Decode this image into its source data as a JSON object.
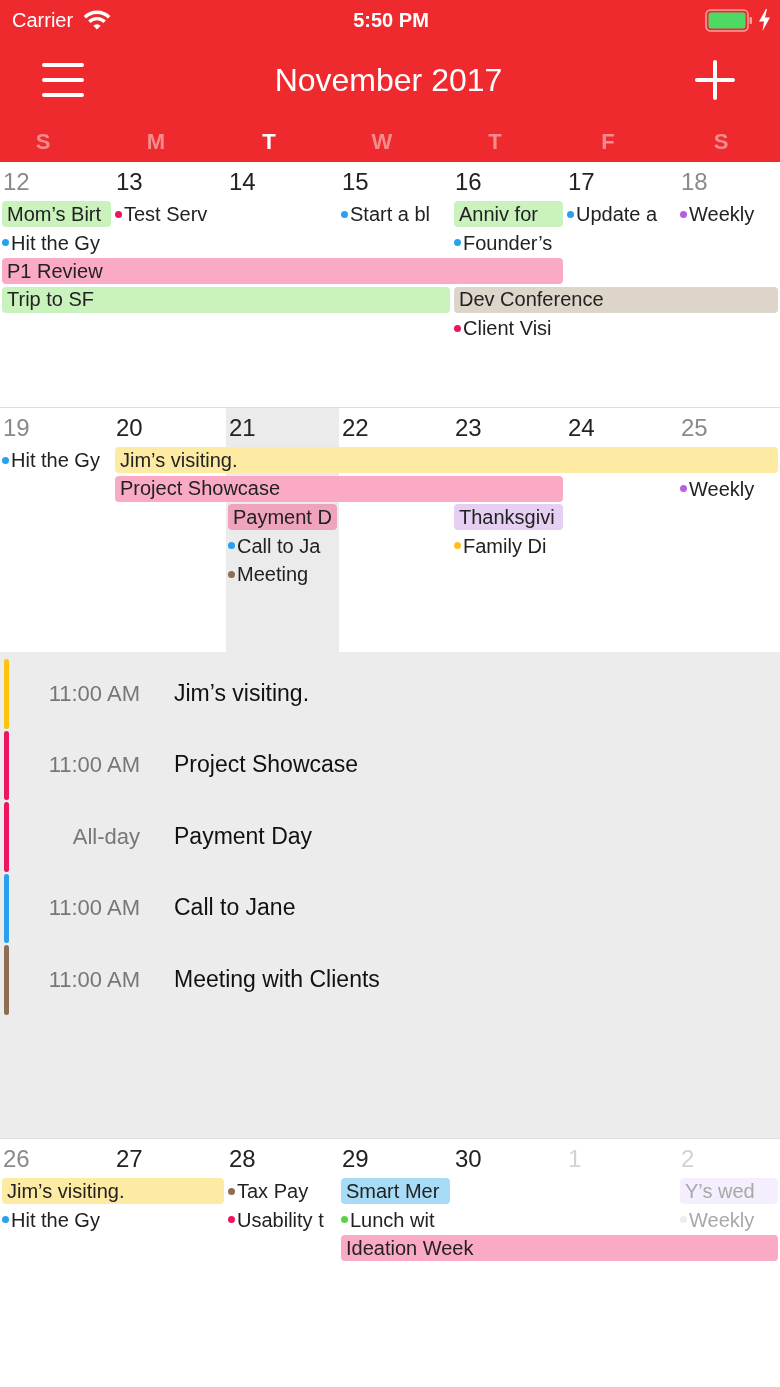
{
  "status_bar": {
    "carrier": "Carrier",
    "time": "5:50 PM"
  },
  "nav_bar": {
    "title": "November 2017"
  },
  "weekdays": [
    {
      "label": "S",
      "selected": false
    },
    {
      "label": "M",
      "selected": false
    },
    {
      "label": "T",
      "selected": true
    },
    {
      "label": "W",
      "selected": false
    },
    {
      "label": "T",
      "selected": false
    },
    {
      "label": "F",
      "selected": false
    },
    {
      "label": "S",
      "selected": false
    }
  ],
  "weeks": [
    {
      "days": [
        {
          "label": "12",
          "kind": "weekend",
          "selected": false
        },
        {
          "label": "13",
          "kind": "weekday",
          "selected": false
        },
        {
          "label": "14",
          "kind": "weekday",
          "selected": false
        },
        {
          "label": "15",
          "kind": "weekday",
          "selected": false
        },
        {
          "label": "16",
          "kind": "weekday",
          "selected": false
        },
        {
          "label": "17",
          "kind": "weekday",
          "selected": false
        },
        {
          "label": "18",
          "kind": "weekend",
          "selected": false
        }
      ],
      "lanes": [
        [
          {
            "kind": "bar",
            "title": "Mom’s Birt",
            "color": "#c9f2bd"
          },
          {
            "kind": "dot",
            "title": "Test Serv",
            "color": "#ec1561"
          },
          {
            "kind": "empty"
          },
          {
            "kind": "dot",
            "title": "Start a bl",
            "color": "#27a1ef"
          },
          {
            "kind": "bar",
            "title": "Anniv for",
            "color": "#c9f2bd"
          },
          {
            "kind": "dot",
            "title": "Update a",
            "color": "#27a1ef"
          },
          {
            "kind": "dot",
            "title": "Weekly",
            "color": "#b65fe0"
          }
        ],
        [
          {
            "kind": "dot",
            "title": "Hit the Gy",
            "color": "#27a1ef"
          },
          {
            "kind": "empty"
          },
          {
            "kind": "empty"
          },
          {
            "kind": "empty"
          },
          {
            "kind": "dot",
            "title": "Founder’s",
            "color": "#27a1ef"
          }
        ],
        [
          {
            "kind": "bar",
            "title": "P1 Review",
            "color": "#fbaac6"
          },
          {
            "kind": "continues"
          },
          {
            "kind": "continues"
          },
          {
            "kind": "continues"
          },
          {
            "kind": "continues"
          }
        ],
        [
          {
            "kind": "bar",
            "title": "Trip to SF",
            "color": "#c9f2bd"
          },
          {
            "kind": "continues"
          },
          {
            "kind": "continues"
          },
          {
            "kind": "continues"
          },
          {
            "kind": "bar",
            "title": "Dev Conference",
            "color": "#ddd5c9"
          },
          {
            "kind": "continues"
          },
          {
            "kind": "continues"
          }
        ],
        [
          {
            "kind": "empty"
          },
          {
            "kind": "empty"
          },
          {
            "kind": "empty"
          },
          {
            "kind": "empty"
          },
          {
            "kind": "dot",
            "title": "Client Visi",
            "color": "#ec1561"
          }
        ]
      ]
    },
    {
      "days": [
        {
          "label": "19",
          "kind": "weekend",
          "selected": false
        },
        {
          "label": "20",
          "kind": "weekday",
          "selected": false
        },
        {
          "label": "21",
          "kind": "weekday",
          "selected": true
        },
        {
          "label": "22",
          "kind": "weekday",
          "selected": false
        },
        {
          "label": "23",
          "kind": "weekday",
          "selected": false
        },
        {
          "label": "24",
          "kind": "weekday",
          "selected": false
        },
        {
          "label": "25",
          "kind": "weekend",
          "selected": false
        }
      ],
      "lanes": [
        [
          {
            "kind": "dot",
            "title": "Hit the Gy",
            "color": "#27a1ef"
          },
          {
            "kind": "bar",
            "title": "Jim’s visiting.",
            "color": "#fdeaa3"
          },
          {
            "kind": "continues"
          },
          {
            "kind": "continues"
          },
          {
            "kind": "continues"
          },
          {
            "kind": "continues"
          },
          {
            "kind": "continues"
          }
        ],
        [
          {
            "kind": "empty"
          },
          {
            "kind": "bar",
            "title": "Project Showcase",
            "color": "#fbaac6"
          },
          {
            "kind": "continues"
          },
          {
            "kind": "continues"
          },
          {
            "kind": "continues"
          },
          {
            "kind": "empty"
          },
          {
            "kind": "dot",
            "title": "Weekly",
            "color": "#b65fe0"
          }
        ],
        [
          {
            "kind": "empty"
          },
          {
            "kind": "empty"
          },
          {
            "kind": "bar",
            "title": "Payment D",
            "color": "#f0a3bd"
          },
          {
            "kind": "empty"
          },
          {
            "kind": "bar",
            "title": "Thanksgivi",
            "color": "#e5d0f3"
          }
        ],
        [
          {
            "kind": "empty"
          },
          {
            "kind": "empty"
          },
          {
            "kind": "dot",
            "title": "Call to Ja",
            "color": "#27a1ef"
          },
          {
            "kind": "empty"
          },
          {
            "kind": "dot",
            "title": "Family Di",
            "color": "#ffbf1f"
          }
        ],
        [
          {
            "kind": "empty"
          },
          {
            "kind": "empty"
          },
          {
            "kind": "dot",
            "title": "Meeting",
            "color": "#8c6f53"
          }
        ]
      ],
      "agenda": [
        {
          "time": "11:00 AM",
          "title": "Jim’s visiting.",
          "color": "#ffc20e"
        },
        {
          "time": "11:00 AM",
          "title": "Project Showcase",
          "color": "#ec1561"
        },
        {
          "time": "All-day",
          "title": "Payment Day",
          "color": "#ec1561"
        },
        {
          "time": "11:00 AM",
          "title": "Call to Jane",
          "color": "#27a1ef"
        },
        {
          "time": "11:00 AM",
          "title": "Meeting with Clients",
          "color": "#8c6f53"
        }
      ]
    },
    {
      "days": [
        {
          "label": "26",
          "kind": "weekend",
          "selected": false
        },
        {
          "label": "27",
          "kind": "weekday",
          "selected": false
        },
        {
          "label": "28",
          "kind": "weekday",
          "selected": false
        },
        {
          "label": "29",
          "kind": "weekday",
          "selected": false
        },
        {
          "label": "30",
          "kind": "weekday",
          "selected": false
        },
        {
          "label": "1",
          "kind": "outside",
          "selected": false
        },
        {
          "label": "2",
          "kind": "outside",
          "selected": false
        }
      ],
      "lanes": [
        [
          {
            "kind": "bar",
            "title": "Jim’s visiting.",
            "color": "#fdeaa3"
          },
          {
            "kind": "continues"
          },
          {
            "kind": "dot",
            "title": "Tax Pay",
            "color": "#8c6f53"
          },
          {
            "kind": "bar",
            "title": "Smart Mer",
            "color": "#a8dcf6"
          },
          {
            "kind": "empty"
          },
          {
            "kind": "empty"
          },
          {
            "kind": "bar",
            "title": "Y’s wed",
            "color": "#f5eefc"
          }
        ],
        [
          {
            "kind": "dot",
            "title": "Hit the Gy",
            "color": "#27a1ef"
          },
          {
            "kind": "empty"
          },
          {
            "kind": "dot",
            "title": "Usability t",
            "color": "#ec1561"
          },
          {
            "kind": "dot",
            "title": "Lunch wit",
            "color": "#58d143"
          },
          {
            "kind": "empty"
          },
          {
            "kind": "empty"
          },
          {
            "kind": "dot",
            "title": "Weekly",
            "color": "#eeeeee"
          }
        ],
        [
          {
            "kind": "empty"
          },
          {
            "kind": "empty"
          },
          {
            "kind": "empty"
          },
          {
            "kind": "bar",
            "title": "Ideation Week",
            "color": "#fbaac6"
          },
          {
            "kind": "continues"
          },
          {
            "kind": "continues"
          },
          {
            "kind": "continues"
          }
        ]
      ]
    }
  ]
}
